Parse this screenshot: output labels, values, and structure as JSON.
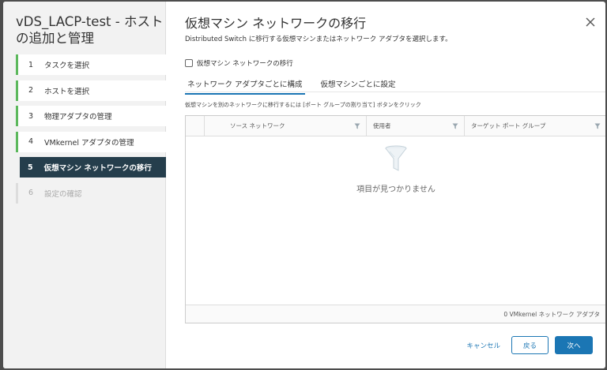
{
  "wizard": {
    "title": "vDS_LACP-test - ホストの追加と管理",
    "steps": [
      {
        "num": "1",
        "label": "タスクを選択"
      },
      {
        "num": "2",
        "label": "ホストを選択"
      },
      {
        "num": "3",
        "label": "物理アダプタの管理"
      },
      {
        "num": "4",
        "label": "VMkernel アダプタの管理"
      },
      {
        "num": "5",
        "label": "仮想マシン ネットワークの移行"
      },
      {
        "num": "6",
        "label": "設定の確認"
      }
    ],
    "active_step": "5"
  },
  "page": {
    "title": "仮想マシン ネットワークの移行",
    "subtitle": "Distributed Switch に移行する仮想マシンまたはネットワーク アダプタを選択します。",
    "migrate_checkbox_label": "仮想マシン ネットワークの移行",
    "migrate_checked": false
  },
  "tabs": [
    {
      "label": "ネットワーク アダプタごとに構成",
      "active": true
    },
    {
      "label": "仮想マシンごとに設定",
      "active": false
    }
  ],
  "hint": "仮想マシンを別のネットワークに移行するには [ポート グループの割り当て] ボタンをクリック",
  "grid": {
    "columns": [
      "ソース ネットワーク",
      "使用者",
      "ターゲット ポート グループ"
    ],
    "empty_text": "項目が見つかりません",
    "footer": "0 VMkernel ネットワーク アダプタ"
  },
  "buttons": {
    "cancel": "キャンセル",
    "back": "戻る",
    "next": "次へ"
  },
  "colors": {
    "accent": "#1b76b4",
    "active_step_bg": "#253e4c",
    "done_marker": "#5cb85c"
  }
}
